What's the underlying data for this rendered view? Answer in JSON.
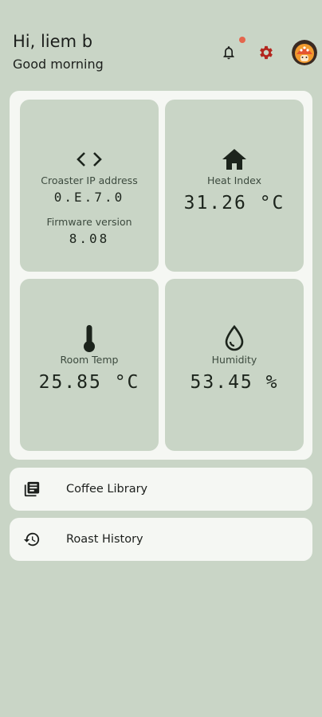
{
  "header": {
    "greeting": "Hi, liem b",
    "subtitle": "Good morning",
    "icons": {
      "notifications": "bell-icon",
      "settings": "gear-icon",
      "avatar": "avatar-icon"
    },
    "colors": {
      "badge": "#e4664d",
      "settings_icon": "#b3261e"
    }
  },
  "dashboard": {
    "croaster": {
      "icon": "code-icon",
      "ip_label": "Croaster IP address",
      "ip_value": "0.E.7.0",
      "firmware_label": "Firmware version",
      "firmware_value": "8.08"
    },
    "heat_index": {
      "icon": "home-icon",
      "label": "Heat Index",
      "value": "31.26 °C"
    },
    "room_temp": {
      "icon": "thermometer-icon",
      "label": "Room Temp",
      "value": "25.85 °C"
    },
    "humidity": {
      "icon": "water-drop-icon",
      "label": "Humidity",
      "value": "53.45 %"
    }
  },
  "menu": [
    {
      "icon": "library-icon",
      "label": "Coffee Library"
    },
    {
      "icon": "history-icon",
      "label": "Roast History"
    }
  ],
  "colors": {
    "background": "#c9d5c6",
    "surface": "#f5f7f3"
  }
}
